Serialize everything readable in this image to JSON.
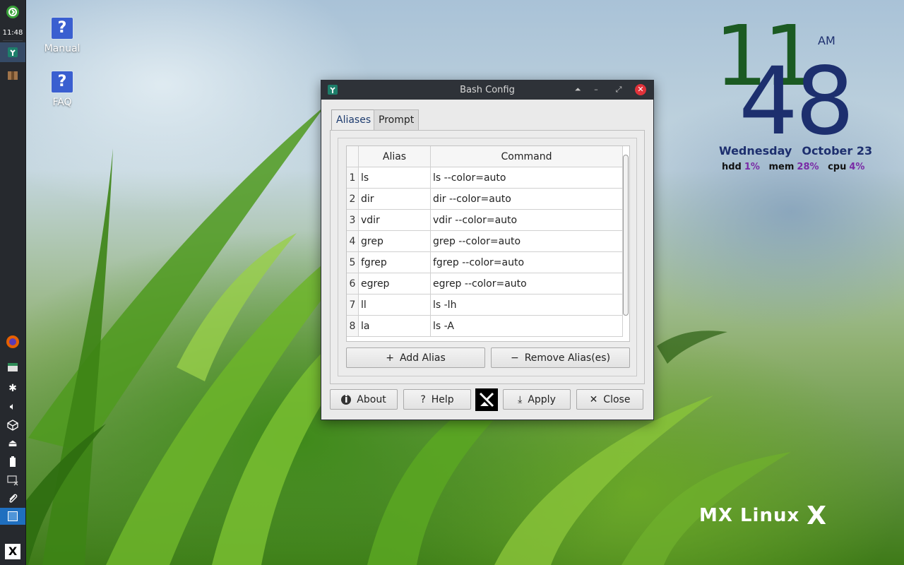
{
  "panel": {
    "clock": "11:48"
  },
  "desktop_icons": [
    {
      "label": "Manual"
    },
    {
      "label": "FAQ"
    }
  ],
  "conky": {
    "hour": "11",
    "minute": "48",
    "ampm": "AM",
    "weekday": "Wednesday",
    "date": "October 23",
    "stats": [
      {
        "label": "hdd",
        "value": "1%"
      },
      {
        "label": "mem",
        "value": "28%"
      },
      {
        "label": "cpu",
        "value": "4%"
      }
    ]
  },
  "logo": {
    "text": "MX Linux"
  },
  "window": {
    "title": "Bash Config",
    "tabs": [
      {
        "label": "Aliases",
        "active": true
      },
      {
        "label": "Prompt",
        "active": false
      }
    ],
    "table": {
      "headers": [
        "Alias",
        "Command"
      ],
      "rows": [
        {
          "num": "1",
          "alias": "ls",
          "command": "ls --color=auto"
        },
        {
          "num": "2",
          "alias": "dir",
          "command": "dir --color=auto"
        },
        {
          "num": "3",
          "alias": "vdir",
          "command": "vdir --color=auto"
        },
        {
          "num": "4",
          "alias": "grep",
          "command": "grep --color=auto"
        },
        {
          "num": "5",
          "alias": "fgrep",
          "command": "fgrep --color=auto"
        },
        {
          "num": "6",
          "alias": "egrep",
          "command": "egrep --color=auto"
        },
        {
          "num": "7",
          "alias": "ll",
          "command": "ls -lh"
        },
        {
          "num": "8",
          "alias": "la",
          "command": "ls -A"
        }
      ]
    },
    "buttons": {
      "add_alias": "Add Alias",
      "remove_alias": "Remove Alias(es)",
      "about": "About",
      "help": "Help",
      "apply": "Apply",
      "close": "Close"
    }
  },
  "colors": {
    "clock_hour": "#1b5a22",
    "clock_minute": "#1d2f6e",
    "stat_value": "#7a2aa6",
    "close_button": "#e0323a"
  }
}
